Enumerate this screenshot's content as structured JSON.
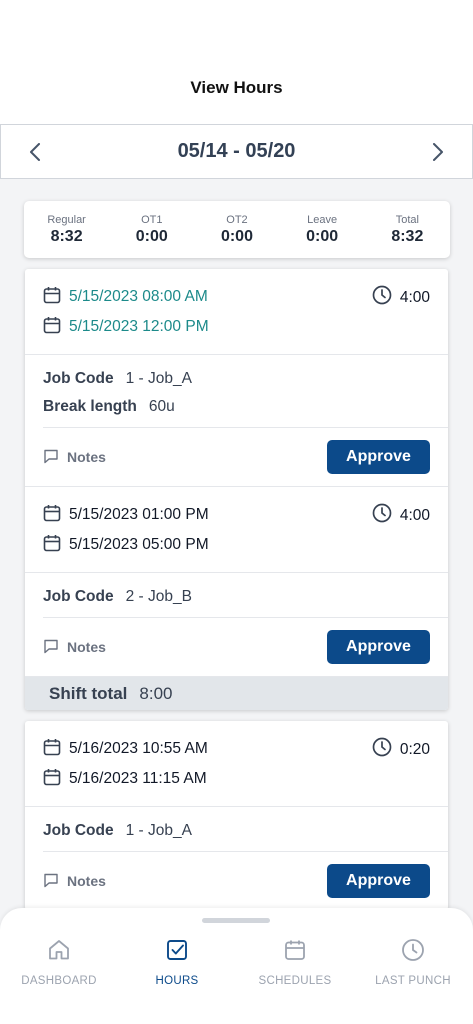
{
  "header": {
    "title": "View Hours"
  },
  "week": {
    "range": "05/14 - 05/20"
  },
  "summary": [
    {
      "label": "Regular",
      "value": "8:32"
    },
    {
      "label": "OT1",
      "value": "0:00"
    },
    {
      "label": "OT2",
      "value": "0:00"
    },
    {
      "label": "Leave",
      "value": "0:00"
    },
    {
      "label": "Total",
      "value": "8:32"
    }
  ],
  "entries": [
    {
      "start": "5/15/2023 08:00 AM",
      "end": "5/15/2023 12:00 PM",
      "duration": "4:00",
      "job_code_label": "Job Code",
      "job_code": "1 - Job_A",
      "break_label": "Break length",
      "break_value": "60u",
      "notes_label": "Notes",
      "approve_label": "Approve"
    },
    {
      "start": "5/15/2023 01:00 PM",
      "end": "5/15/2023 05:00 PM",
      "duration": "4:00",
      "job_code_label": "Job Code",
      "job_code": "2 - Job_B",
      "notes_label": "Notes",
      "approve_label": "Approve"
    },
    {
      "start": "5/16/2023 10:55 AM",
      "end": "5/16/2023 11:15 AM",
      "duration": "0:20",
      "job_code_label": "Job Code",
      "job_code": "1 - Job_A",
      "notes_label": "Notes",
      "approve_label": "Approve"
    }
  ],
  "shift_total": {
    "label": "Shift total",
    "value": "8:00"
  },
  "nav": {
    "items": [
      {
        "label": "DASHBOARD",
        "icon": "home-icon"
      },
      {
        "label": "HOURS",
        "icon": "checkbox-icon"
      },
      {
        "label": "SCHEDULES",
        "icon": "calendar-icon"
      },
      {
        "label": "LAST PUNCH",
        "icon": "clock-icon"
      }
    ]
  },
  "colors": {
    "accent": "#0c4a8a",
    "start_date_green": "#1c8a8a",
    "shift_total_bg": "#e2e6ea"
  }
}
